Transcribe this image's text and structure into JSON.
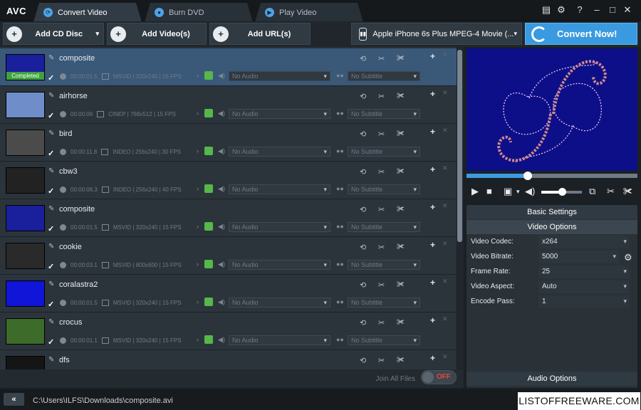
{
  "app": {
    "logo": "AVC"
  },
  "tabs": [
    {
      "label": "Convert Video",
      "icon": "refresh-icon"
    },
    {
      "label": "Burn DVD",
      "icon": "disc-icon"
    },
    {
      "label": "Play Video",
      "icon": "play-icon"
    }
  ],
  "window_controls": {
    "menu": "▤",
    "settings": "⚙",
    "help": "?",
    "minimize": "–",
    "maximize": "□",
    "close": "✕"
  },
  "toolbar": {
    "add_cd": "Add CD Disc",
    "add_video": "Add Video(s)",
    "add_url": "Add URL(s)",
    "profile": "Apple iPhone 6s Plus MPEG-4 Movie (...",
    "convert": "Convert Now!"
  },
  "files": [
    {
      "name": "composite",
      "duration": "00:00:01.5",
      "info": "MSVID | 320x240 | 15 FPS",
      "audio": "No Audio",
      "subtitle": "No Subtitle",
      "status": "Completed",
      "thumb": "#1a1f9c"
    },
    {
      "name": "airhorse",
      "duration": "00:00:06",
      "info": "CINEP | 768x512 | 15 FPS",
      "audio": "No Audio",
      "subtitle": "No Subtitle",
      "thumb": "#6f8ec9"
    },
    {
      "name": "bird",
      "duration": "00:00:11.8",
      "info": "INDEO | 256x240 | 30 FPS",
      "audio": "No Audio",
      "subtitle": "No Subtitle",
      "thumb": "#4b4b4b"
    },
    {
      "name": "cbw3",
      "duration": "00:00:06.3",
      "info": "INDEO | 256x240 | 40 FPS",
      "audio": "No Audio",
      "subtitle": "No Subtitle",
      "thumb": "#222222"
    },
    {
      "name": "composite",
      "duration": "00:00:01.5",
      "info": "MSVID | 320x240 | 15 FPS",
      "audio": "No Audio",
      "subtitle": "No Subtitle",
      "thumb": "#1a1f9c"
    },
    {
      "name": "cookie",
      "duration": "00:00:03.1",
      "info": "MSVID | 800x600 | 15 FPS",
      "audio": "No Audio",
      "subtitle": "No Subtitle",
      "thumb": "#2a2a2a"
    },
    {
      "name": "coralastra2",
      "duration": "00:00:01.5",
      "info": "MSVID | 320x240 | 15 FPS",
      "audio": "No Audio",
      "subtitle": "No Subtitle",
      "thumb": "#1015d8"
    },
    {
      "name": "crocus",
      "duration": "00:00:01.1",
      "info": "MSVID | 320x240 | 15 FPS",
      "audio": "No Audio",
      "subtitle": "No Subtitle",
      "thumb": "#3c6b2a"
    },
    {
      "name": "dfs",
      "duration": "",
      "info": "",
      "audio": "",
      "subtitle": "",
      "thumb": "#151515"
    }
  ],
  "footer": {
    "join_label": "Join All Files",
    "toggle": "OFF"
  },
  "settings": {
    "basic": "Basic Settings",
    "video_options": "Video Options",
    "audio_options": "Audio Options",
    "rows": [
      {
        "label": "Video Codec:",
        "value": "x264"
      },
      {
        "label": "Video Bitrate:",
        "value": "5000"
      },
      {
        "label": "Frame Rate:",
        "value": "25"
      },
      {
        "label": "Video Aspect:",
        "value": "Auto"
      },
      {
        "label": "Encode Pass:",
        "value": "1"
      }
    ]
  },
  "player": {
    "seek_fraction": 0.36,
    "volume_fraction": 0.5
  },
  "status": {
    "path": "C:\\Users\\ILFS\\Downloads\\composite.avi",
    "back": "«"
  },
  "watermark": "LISTOFFREEWARE.COM",
  "colors": {
    "accent": "#3a9ae0",
    "selected_row": "#3a5878",
    "toggle_off": "#e24a3a",
    "completed": "#3fa23f"
  }
}
